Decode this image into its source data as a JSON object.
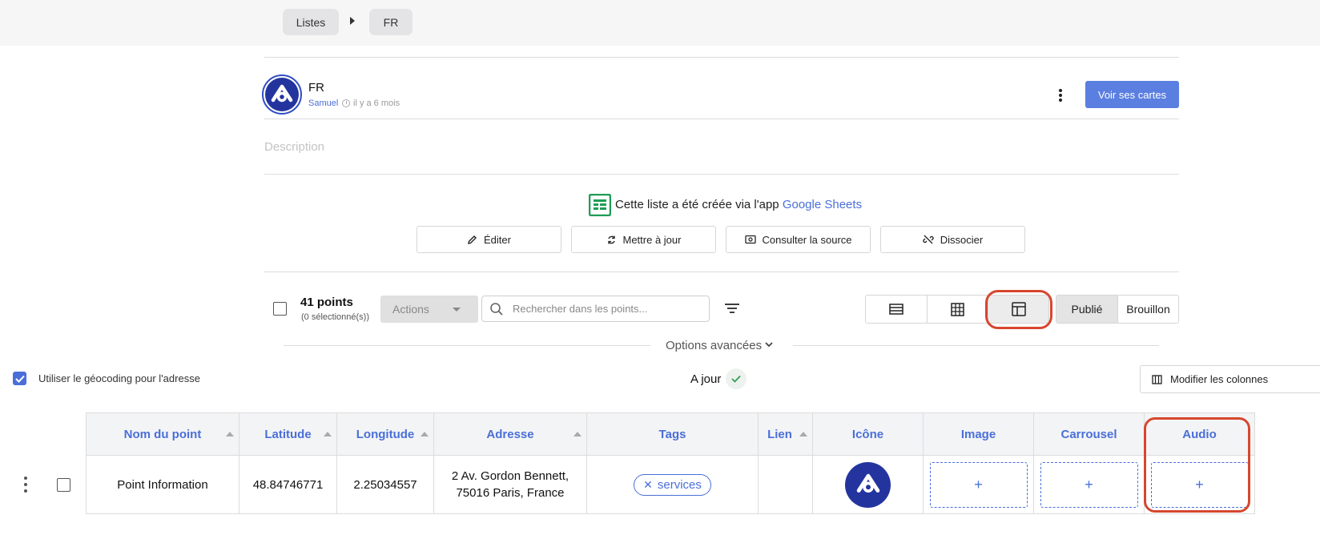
{
  "breadcrumb": {
    "items": [
      "Listes",
      "FR"
    ]
  },
  "header": {
    "title": "FR",
    "author": "Samuel",
    "time_ago": "il y a 6 mois",
    "view_maps_button": "Voir ses cartes",
    "description_placeholder": "Description"
  },
  "source": {
    "text": "Cette liste a été créée via l'app ",
    "app_name": "Google Sheets",
    "buttons": {
      "edit": "Éditer",
      "update": "Mettre à jour",
      "view_source": "Consulter la source",
      "dissociate": "Dissocier"
    }
  },
  "toolbar": {
    "points_count": "41 points",
    "selected": "(0 sélectionné(s))",
    "actions_label": "Actions",
    "search_placeholder": "Rechercher dans les points...",
    "status_published": "Publié",
    "status_draft": "Brouillon",
    "advanced_options": "Options avancées"
  },
  "geocoding": {
    "label": "Utiliser le géocoding pour l'adresse",
    "checked": true,
    "sync_status": "A jour",
    "modify_columns": "Modifier les colonnes"
  },
  "table": {
    "columns": [
      "Nom du point",
      "Latitude",
      "Longitude",
      "Adresse",
      "Tags",
      "Lien",
      "Icône",
      "Image",
      "Carrousel",
      "Audio"
    ],
    "rows": [
      {
        "name": "Point Information",
        "latitude": "48.84746771",
        "longitude": "2.25034557",
        "address_line1": "2 Av. Gordon Bennett,",
        "address_line2": "75016 Paris, France",
        "tag": "services",
        "link": "",
        "image_add": "+",
        "carousel_add": "+",
        "audio_add": "+"
      }
    ]
  },
  "colors": {
    "accent": "#4a6fd8",
    "brand_dark": "#24349f",
    "highlight": "#d6472f",
    "sheets_green": "#1f9d55"
  }
}
